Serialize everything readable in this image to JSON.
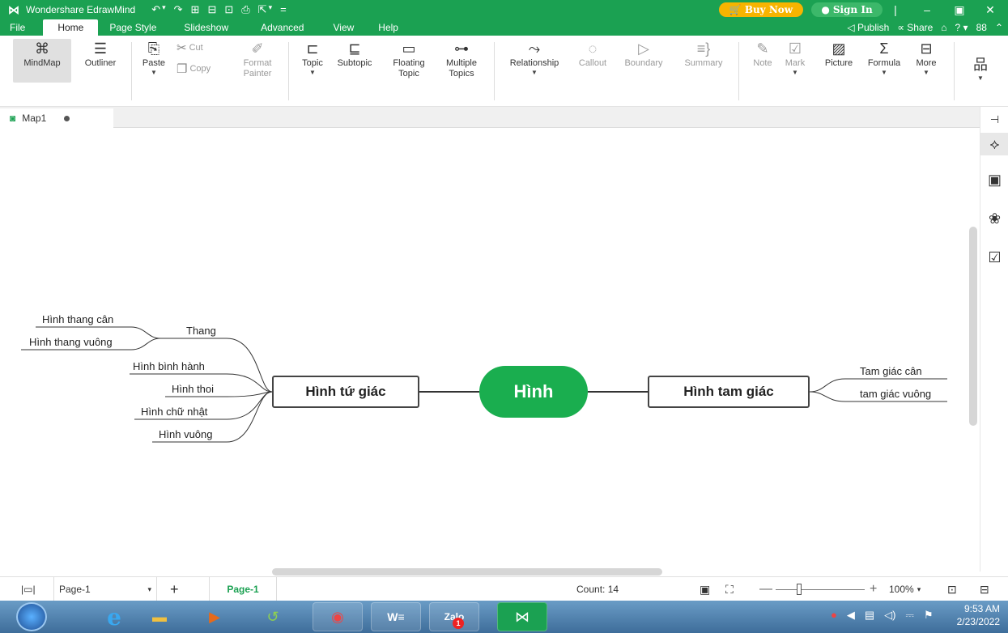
{
  "app": {
    "title": "Wondershare EdrawMind",
    "logo_icon": "edrawmind-logo-icon",
    "quick_access": [
      "↶",
      "▾",
      "↷",
      "⊞",
      "⊟",
      "⊡",
      "⎙",
      "⇱",
      "▾",
      "="
    ],
    "buy_now": "Buy Now",
    "sign_in": "Sign In"
  },
  "menu": {
    "items": [
      "File",
      "Home",
      "Page Style",
      "Slideshow",
      "Advanced",
      "View",
      "Help"
    ],
    "active": "Home",
    "publish": "Publish",
    "share": "Share"
  },
  "ribbon": {
    "mindmap": "MindMap",
    "outliner": "Outliner",
    "paste": "Paste",
    "cut": "Cut",
    "copy": "Copy",
    "format_painter_1": "Format",
    "format_painter_2": "Painter",
    "topic": "Topic",
    "subtopic": "Subtopic",
    "floating_1": "Floating",
    "floating_2": "Topic",
    "multiple_1": "Multiple",
    "multiple_2": "Topics",
    "relationship": "Relationship",
    "callout": "Callout",
    "boundary": "Boundary",
    "summary": "Summary",
    "note": "Note",
    "mark": "Mark",
    "picture": "Picture",
    "formula": "Formula",
    "more": "More"
  },
  "document": {
    "tab_name": "Map1"
  },
  "mindmap": {
    "central": "Hình",
    "left_main": "Hình tứ giác",
    "right_main": "Hình tam giác",
    "left_subtopics": {
      "thang": "Thang",
      "thang_children": [
        "Hình thang cân",
        "Hình thang vuông"
      ],
      "others": [
        "Hình bình hành",
        "Hình thoi",
        "Hình chữ nhật",
        "Hình vuông"
      ]
    },
    "right_subtopics": [
      "Tam giác cân",
      "tam giác vuông"
    ],
    "colors": {
      "central": "#1aae4f",
      "brand": "#1ba152",
      "buy_now": "#f7b400"
    }
  },
  "statusbar": {
    "page_selector": "Page-1",
    "active_page": "Page-1",
    "count": "Count: 14",
    "zoom": "100%"
  },
  "taskbar": {
    "time": "9:53 AM",
    "date": "2/23/2022",
    "zalo_badge": "1"
  }
}
